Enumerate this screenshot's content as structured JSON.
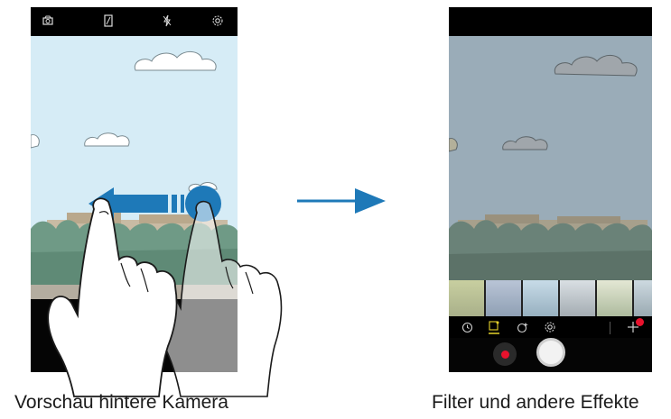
{
  "left_screen": {
    "toolbar_icons": [
      "camera-switch-icon",
      "aspect-ratio-icon",
      "flash-off-icon",
      "settings-icon"
    ],
    "bottom": {
      "record_button": "record-icon"
    }
  },
  "right_screen": {
    "filter_thumbnails": 6,
    "effect_icons": [
      "timer-icon",
      "filter-icon",
      "beauty-icon",
      "settings-icon",
      "add-effect-icon"
    ],
    "bottom": {
      "record_button": "record-icon",
      "shutter_button": "shutter-icon"
    }
  },
  "captions": {
    "left": "Vorschau hintere Kamera",
    "right": "Filter und andere Effekte"
  },
  "colors": {
    "sky": "#d6ecf6",
    "filtered_sky": "#9aacb8",
    "arrow": "#1e79b8",
    "record": "#e8122d",
    "active_icon": "#e6d22b"
  }
}
